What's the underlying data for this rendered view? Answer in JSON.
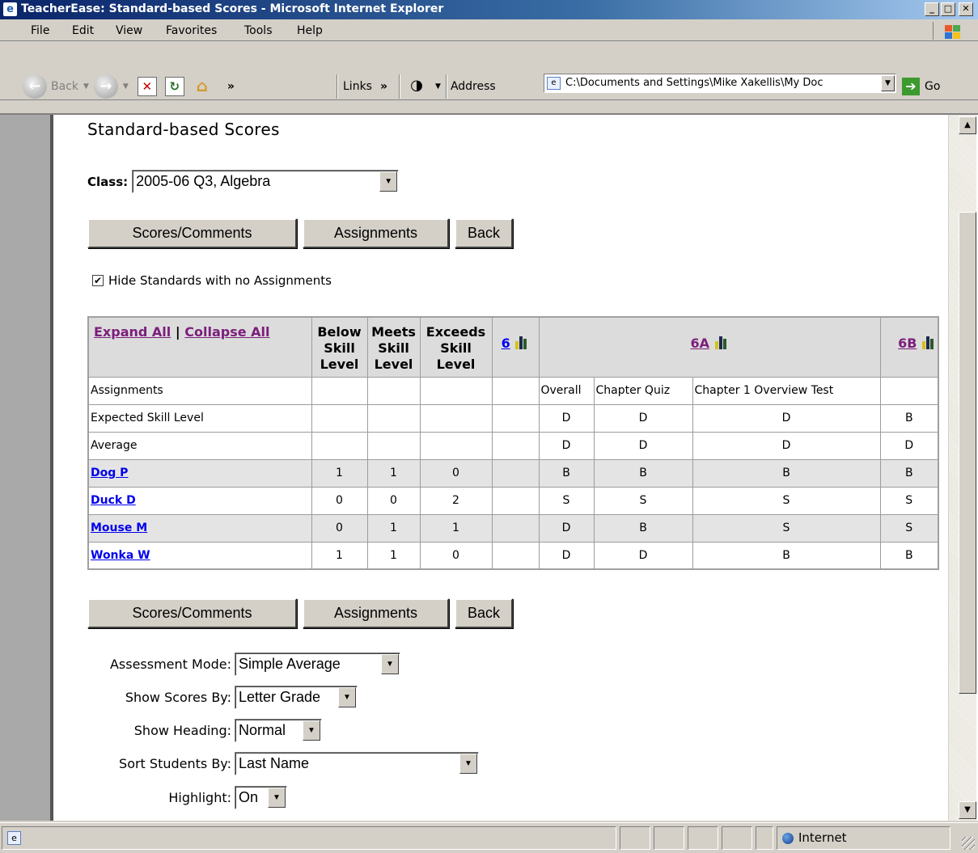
{
  "window": {
    "title": "TeacherEase: Standard-based Scores - Microsoft Internet Explorer",
    "btn_min": "_",
    "btn_max": "□",
    "btn_close": "✕"
  },
  "menu": [
    {
      "label": "File"
    },
    {
      "label": "Edit"
    },
    {
      "label": "View"
    },
    {
      "label": "Favorites"
    },
    {
      "label": "Tools"
    },
    {
      "label": "Help"
    }
  ],
  "toolbar": {
    "back_label": "Back",
    "links_label": "Links",
    "chevron": "»",
    "address_label": "Address",
    "address_value": "C:\\Documents and Settings\\Mike Xakellis\\My Doc",
    "go_label": "Go"
  },
  "page": {
    "title": "Standard-based Scores",
    "class_label": "Class:",
    "class_value": "2005-06 Q3, Algebra",
    "buttons": {
      "scores_comments": "Scores/Comments",
      "assignments": "Assignments",
      "back": "Back"
    },
    "hide_standards_label": "Hide Standards with no Assignments",
    "hide_standards_checked": "✔",
    "table": {
      "expand_all": "Expand All",
      "divider": "|",
      "collapse_all": "Collapse All",
      "col_below": "Below Skill Level",
      "col_meets": "Meets Skill Level",
      "col_exceeds": "Exceeds Skill Level",
      "std_6": "6",
      "std_6a": "6A",
      "std_6b": "6B",
      "row_assignments": "Assignments",
      "row_expected": "Expected Skill Level",
      "row_average": "Average",
      "asg_overall": "Overall",
      "asg_quiz": "Chapter Quiz",
      "asg_test": "Chapter 1 Overview Test",
      "expected": [
        "D",
        "D",
        "D",
        "B"
      ],
      "average": [
        "D",
        "D",
        "D",
        "D"
      ],
      "students": [
        {
          "name": "Dog P",
          "below": "1",
          "meets": "1",
          "exceeds": "0",
          "overall": "B",
          "quiz": "B",
          "test": "B",
          "b6": "B"
        },
        {
          "name": "Duck D",
          "below": "0",
          "meets": "0",
          "exceeds": "2",
          "overall": "S",
          "quiz": "S",
          "test": "S",
          "b6": "S"
        },
        {
          "name": "Mouse M",
          "below": "0",
          "meets": "1",
          "exceeds": "1",
          "overall": "D",
          "quiz": "B",
          "test": "S",
          "b6": "S"
        },
        {
          "name": "Wonka W",
          "below": "1",
          "meets": "1",
          "exceeds": "0",
          "overall": "D",
          "quiz": "D",
          "test": "B",
          "b6": "B"
        }
      ]
    },
    "form": {
      "assessment_mode_label": "Assessment Mode:",
      "assessment_mode_value": "Simple Average",
      "show_scores_label": "Show Scores By:",
      "show_scores_value": "Letter Grade",
      "show_heading_label": "Show Heading:",
      "show_heading_value": "Normal",
      "sort_students_label": "Sort Students By:",
      "sort_students_value": "Last Name",
      "highlight_label": "Highlight:",
      "highlight_value": "On"
    }
  },
  "status": {
    "zone": "Internet"
  }
}
